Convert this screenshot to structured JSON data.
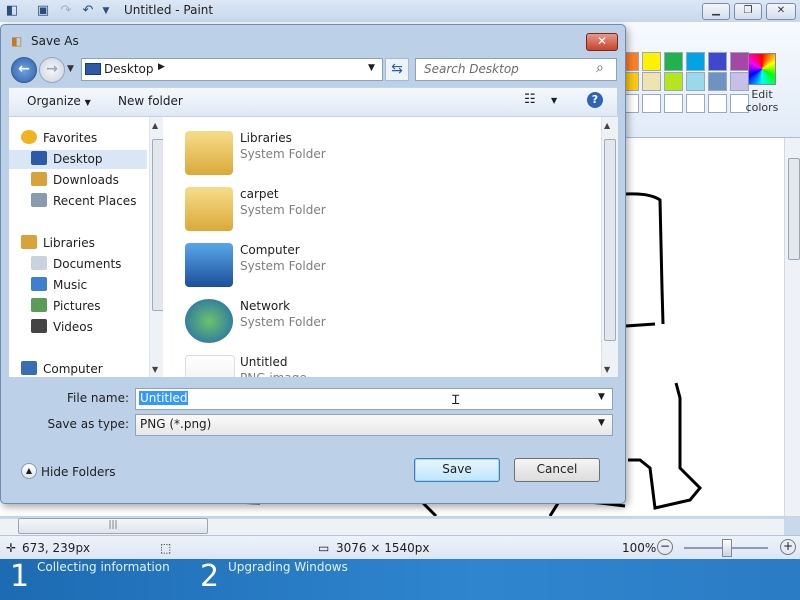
{
  "paint": {
    "title": "Untitled - Paint",
    "edit_colors_label": "Edit colors",
    "palette": [
      "#ff7f27",
      "#fff200",
      "#22b14c",
      "#00a2e8",
      "#3f48cc",
      "#a349a4",
      "#ffc90e",
      "#efe4b0",
      "#b5e61d",
      "#99d9ea",
      "#7092be",
      "#c8bfe7"
    ],
    "status": {
      "cursor_pos": "673, 239px",
      "image_size": "3076 × 1540px",
      "zoom": "100%"
    }
  },
  "taskbar": {
    "steps": [
      {
        "num": "1",
        "label": "Collecting information"
      },
      {
        "num": "2",
        "label": "Upgrading Windows"
      }
    ]
  },
  "dialog": {
    "title": "Save As",
    "address": "Desktop",
    "search_placeholder": "Search Desktop",
    "toolbar": {
      "organize": "Organize",
      "new_folder": "New folder"
    },
    "nav": [
      {
        "label": "Favorites",
        "icon": "star-icon",
        "group": true
      },
      {
        "label": "Desktop",
        "icon": "desktop-icon",
        "selected": true
      },
      {
        "label": "Downloads",
        "icon": "downloads-icon"
      },
      {
        "label": "Recent Places",
        "icon": "recent-places-icon"
      },
      {
        "label": "Libraries",
        "icon": "libraries-icon",
        "group": true
      },
      {
        "label": "Documents",
        "icon": "documents-icon"
      },
      {
        "label": "Music",
        "icon": "music-icon"
      },
      {
        "label": "Pictures",
        "icon": "pictures-icon"
      },
      {
        "label": "Videos",
        "icon": "videos-icon"
      },
      {
        "label": "Computer",
        "icon": "computer-icon",
        "group": true
      }
    ],
    "files": [
      {
        "name": "Libraries",
        "type": "System Folder",
        "icon": "libraries-folder-icon"
      },
      {
        "name": "carpet",
        "type": "System Folder",
        "icon": "user-folder-icon"
      },
      {
        "name": "Computer",
        "type": "System Folder",
        "icon": "computer-icon"
      },
      {
        "name": "Network",
        "type": "System Folder",
        "icon": "network-icon"
      },
      {
        "name": "Untitled",
        "type": "PNG image",
        "icon": "png-file-icon"
      }
    ],
    "file_name_label": "File name:",
    "file_name_value": "Untitled",
    "save_type_label": "Save as type:",
    "save_type_value": "PNG (*.png)",
    "hide_folders": "Hide Folders",
    "save_button": "Save",
    "cancel_button": "Cancel"
  }
}
